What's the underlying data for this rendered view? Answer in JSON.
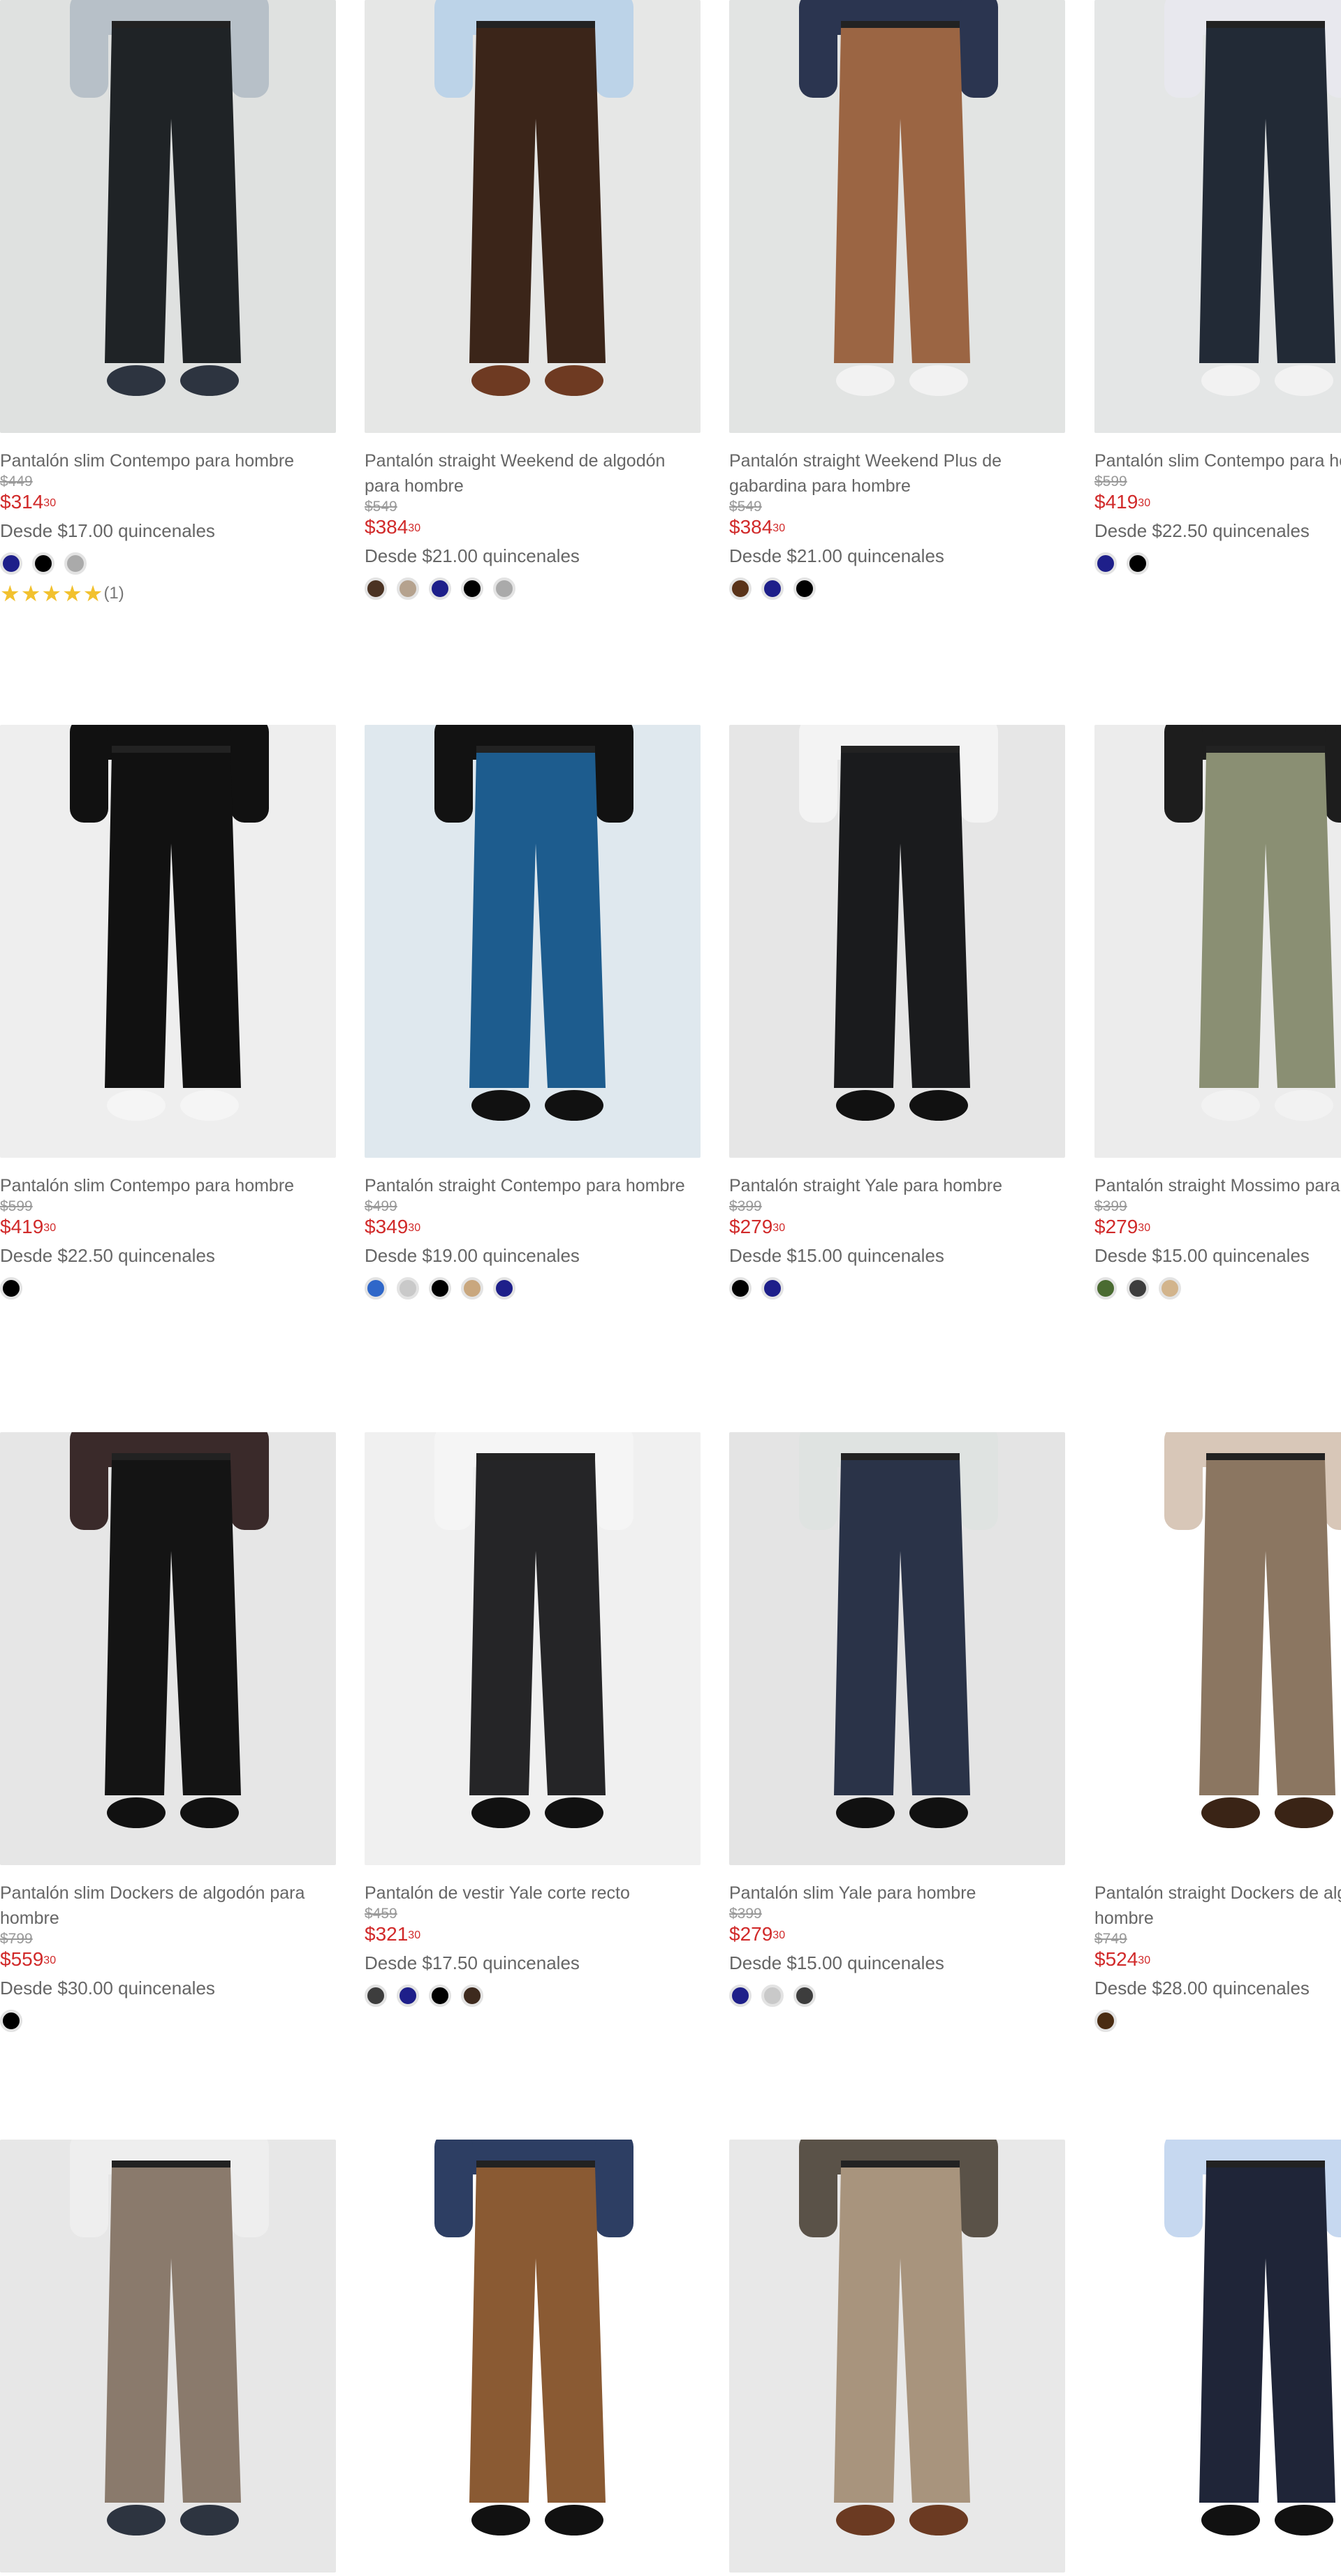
{
  "products": [
    {
      "title": "Pantalón slim Contempo para hombre",
      "old_price": "$449",
      "price_main": "$314",
      "price_cents": "30",
      "installments": "Desde $17.00 quincenales",
      "swatches": [
        "#1e1f8a",
        "#000000",
        "#aaaaaa"
      ],
      "rating_stars": 5,
      "rating_count": "(1)",
      "photo": {
        "bg": "#dfe1e0",
        "pants": "#1f2326",
        "shirt": "#b7c0c8",
        "shoes": "#2d3440"
      }
    },
    {
      "title": "Pantalón straight Weekend de algodón para hombre",
      "old_price": "$549",
      "price_main": "$384",
      "price_cents": "30",
      "installments": "Desde $21.00 quincenales",
      "swatches": [
        "#4b3323",
        "#b5a28e",
        "#1e1f8a",
        "#000000",
        "#aaaaaa"
      ],
      "photo": {
        "bg": "#e6e7e6",
        "pants": "#3b2519",
        "shirt": "#bcd3e8",
        "shoes": "#6e3a22"
      }
    },
    {
      "title": "Pantalón straight Weekend Plus de gabardina para hombre",
      "old_price": "$549",
      "price_main": "$384",
      "price_cents": "30",
      "installments": "Desde $21.00 quincenales",
      "swatches": [
        "#5a3319",
        "#1e1f8a",
        "#000000"
      ],
      "photo": {
        "bg": "#e2e4e3",
        "pants": "#9b6543",
        "shirt": "#2b3550",
        "shoes": "#f2f2f2"
      }
    },
    {
      "title": "Pantalón slim Contempo para hombre",
      "old_price": "$599",
      "price_main": "$419",
      "price_cents": "30",
      "installments": "Desde $22.50 quincenales",
      "swatches": [
        "#1e1f8a",
        "#000000"
      ],
      "photo": {
        "bg": "#e4e6e6",
        "pants": "#222a36",
        "shirt": "#e8e8ee",
        "shoes": "#f2f2f2"
      }
    },
    {
      "title": "Pantalón slim Contempo para hombre",
      "old_price": "$599",
      "price_main": "$419",
      "price_cents": "30",
      "installments": "Desde $22.50 quincenales",
      "swatches": [
        "#000000"
      ],
      "photo": {
        "bg": "#eeeeee",
        "pants": "#111111",
        "shirt": "#111111",
        "shoes": "#f5f5f5"
      }
    },
    {
      "title": "Pantalón straight Contempo para hombre",
      "old_price": "$499",
      "price_main": "$349",
      "price_cents": "30",
      "installments": "Desde $19.00 quincenales",
      "swatches": [
        "#2f67c9",
        "#c9c9c9",
        "#000000",
        "#c9a77e",
        "#1e1f8a"
      ],
      "photo": {
        "bg": "#dfe8ee",
        "pants": "#1d5c8e",
        "shirt": "#121212",
        "shoes": "#111111"
      }
    },
    {
      "title": "Pantalón straight Yale para hombre",
      "old_price": "$399",
      "price_main": "$279",
      "price_cents": "30",
      "installments": "Desde $15.00 quincenales",
      "swatches": [
        "#000000",
        "#1e1f8a"
      ],
      "photo": {
        "bg": "#e6e6e6",
        "pants": "#1a1b1d",
        "shirt": "#f3f3f3",
        "shoes": "#111111"
      }
    },
    {
      "title": "Pantalón straight Mossimo para hombre",
      "old_price": "$399",
      "price_main": "$279",
      "price_cents": "30",
      "installments": "Desde $15.00 quincenales",
      "swatches": [
        "#4a6b31",
        "#3d3d3d",
        "#d2b48c"
      ],
      "photo": {
        "bg": "#ececec",
        "pants": "#8a8f73",
        "shirt": "#1d1d1d",
        "shoes": "#f2f2f2"
      }
    },
    {
      "title": "Pantalón slim Dockers de algodón para hombre",
      "old_price": "$799",
      "price_main": "$559",
      "price_cents": "30",
      "installments": "Desde $30.00 quincenales",
      "swatches": [
        "#000000"
      ],
      "photo": {
        "bg": "#e6e6e6",
        "pants": "#141414",
        "shirt": "#3a2a2a",
        "shoes": "#111111"
      }
    },
    {
      "title": "Pantalón de vestir Yale corte recto",
      "old_price": "$459",
      "price_main": "$321",
      "price_cents": "30",
      "installments": "Desde $17.50 quincenales",
      "swatches": [
        "#3d3d3d",
        "#1e1f8a",
        "#000000",
        "#3e2a1e"
      ],
      "photo": {
        "bg": "#f0f0f0",
        "pants": "#252527",
        "shirt": "#f5f5f5",
        "shoes": "#111111"
      }
    },
    {
      "title": "Pantalón slim Yale para hombre",
      "old_price": "$399",
      "price_main": "$279",
      "price_cents": "30",
      "installments": "Desde $15.00 quincenales",
      "swatches": [
        "#1e1f8a",
        "#c9c9c9",
        "#3d3d3d"
      ],
      "photo": {
        "bg": "#e4e4e4",
        "pants": "#2a3348",
        "shirt": "#dfe3e1",
        "shoes": "#111111"
      }
    },
    {
      "title": "Pantalón straight Dockers de algodón para hombre",
      "old_price": "$749",
      "price_main": "$524",
      "price_cents": "30",
      "installments": "Desde $28.00 quincenales",
      "swatches": [
        "#4a2c12"
      ],
      "photo": {
        "bg": "#ffffff",
        "pants": "#8b7661",
        "shirt": "#d8c7b8",
        "shoes": "#3a2416"
      }
    },
    {
      "title": "",
      "photo": {
        "bg": "#e7e7e7",
        "pants": "#8a7a6c",
        "shirt": "#eeeeee",
        "shoes": "#2d3440"
      }
    },
    {
      "title": "",
      "photo": {
        "bg": "#ffffff",
        "pants": "#8a5a33",
        "shirt": "#2d3e63",
        "shoes": "#111111"
      }
    },
    {
      "title": "",
      "photo": {
        "bg": "#e8e8e8",
        "pants": "#a8947d",
        "shirt": "#5a5248",
        "shoes": "#6b3a22"
      }
    },
    {
      "title": "",
      "photo": {
        "bg": "#ffffff",
        "pants": "#1f2538",
        "shirt": "#c6d8f0",
        "shoes": "#111111"
      }
    }
  ]
}
